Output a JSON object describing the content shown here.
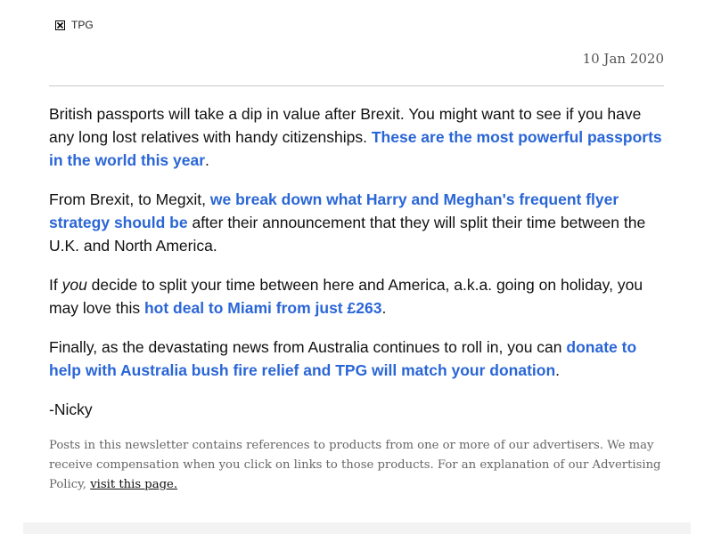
{
  "header": {
    "logo_alt": "TPG",
    "date": "10 Jan 2020"
  },
  "paragraph1": {
    "text": "British passports will take a dip in value after Brexit. You might want to see if you have any long lost relatives with handy citizenships. ",
    "link": "These are the most powerful passports in the world this year",
    "end": "."
  },
  "paragraph2": {
    "text": "From Brexit, to Megxit, ",
    "link": "we break down what Harry and Meghan's frequent flyer strategy should be",
    "text_after": " after their announcement that they will split their time between the U.K. and North America."
  },
  "paragraph3": {
    "text_before": "If ",
    "emphasis": "you",
    "text": " decide to split your time between here and America, a.k.a. going on holiday, you may love this ",
    "link": "hot deal to Miami from just £263",
    "end": "."
  },
  "paragraph4": {
    "text": "Finally, as the devastating news from Australia continues to roll in, you can ",
    "link": "donate to help with Australia bush fire relief and TPG will match your donation",
    "end": "."
  },
  "signoff": "-Nicky",
  "disclaimer": {
    "text": "Posts in this newsletter contains references to products from one or more of our advertisers. We may receive compensation when you click on links to those products. For an explanation of our Advertising Policy, ",
    "link": "visit this page."
  }
}
